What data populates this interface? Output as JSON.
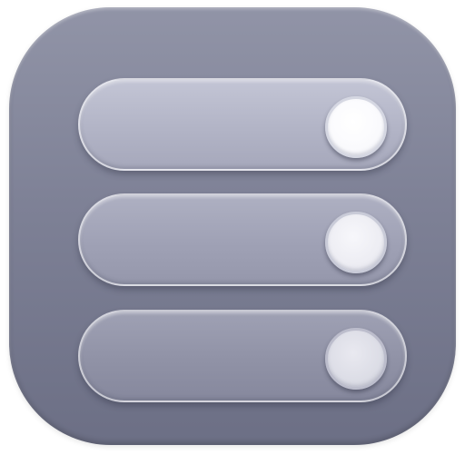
{
  "app_icon": {
    "icon_name": "toggle-switches-app-icon",
    "colors": {
      "background_top": "#9194a7",
      "background_bottom": "#6c6f85",
      "toggle_1": "#b2b4c6",
      "toggle_2": "#9fa1b5",
      "toggle_3": "#9092a6",
      "knob": "#ffffff"
    },
    "toggles": [
      {
        "name": "toggle-switch-1",
        "state": "on"
      },
      {
        "name": "toggle-switch-2",
        "state": "on"
      },
      {
        "name": "toggle-switch-3",
        "state": "on"
      }
    ]
  }
}
